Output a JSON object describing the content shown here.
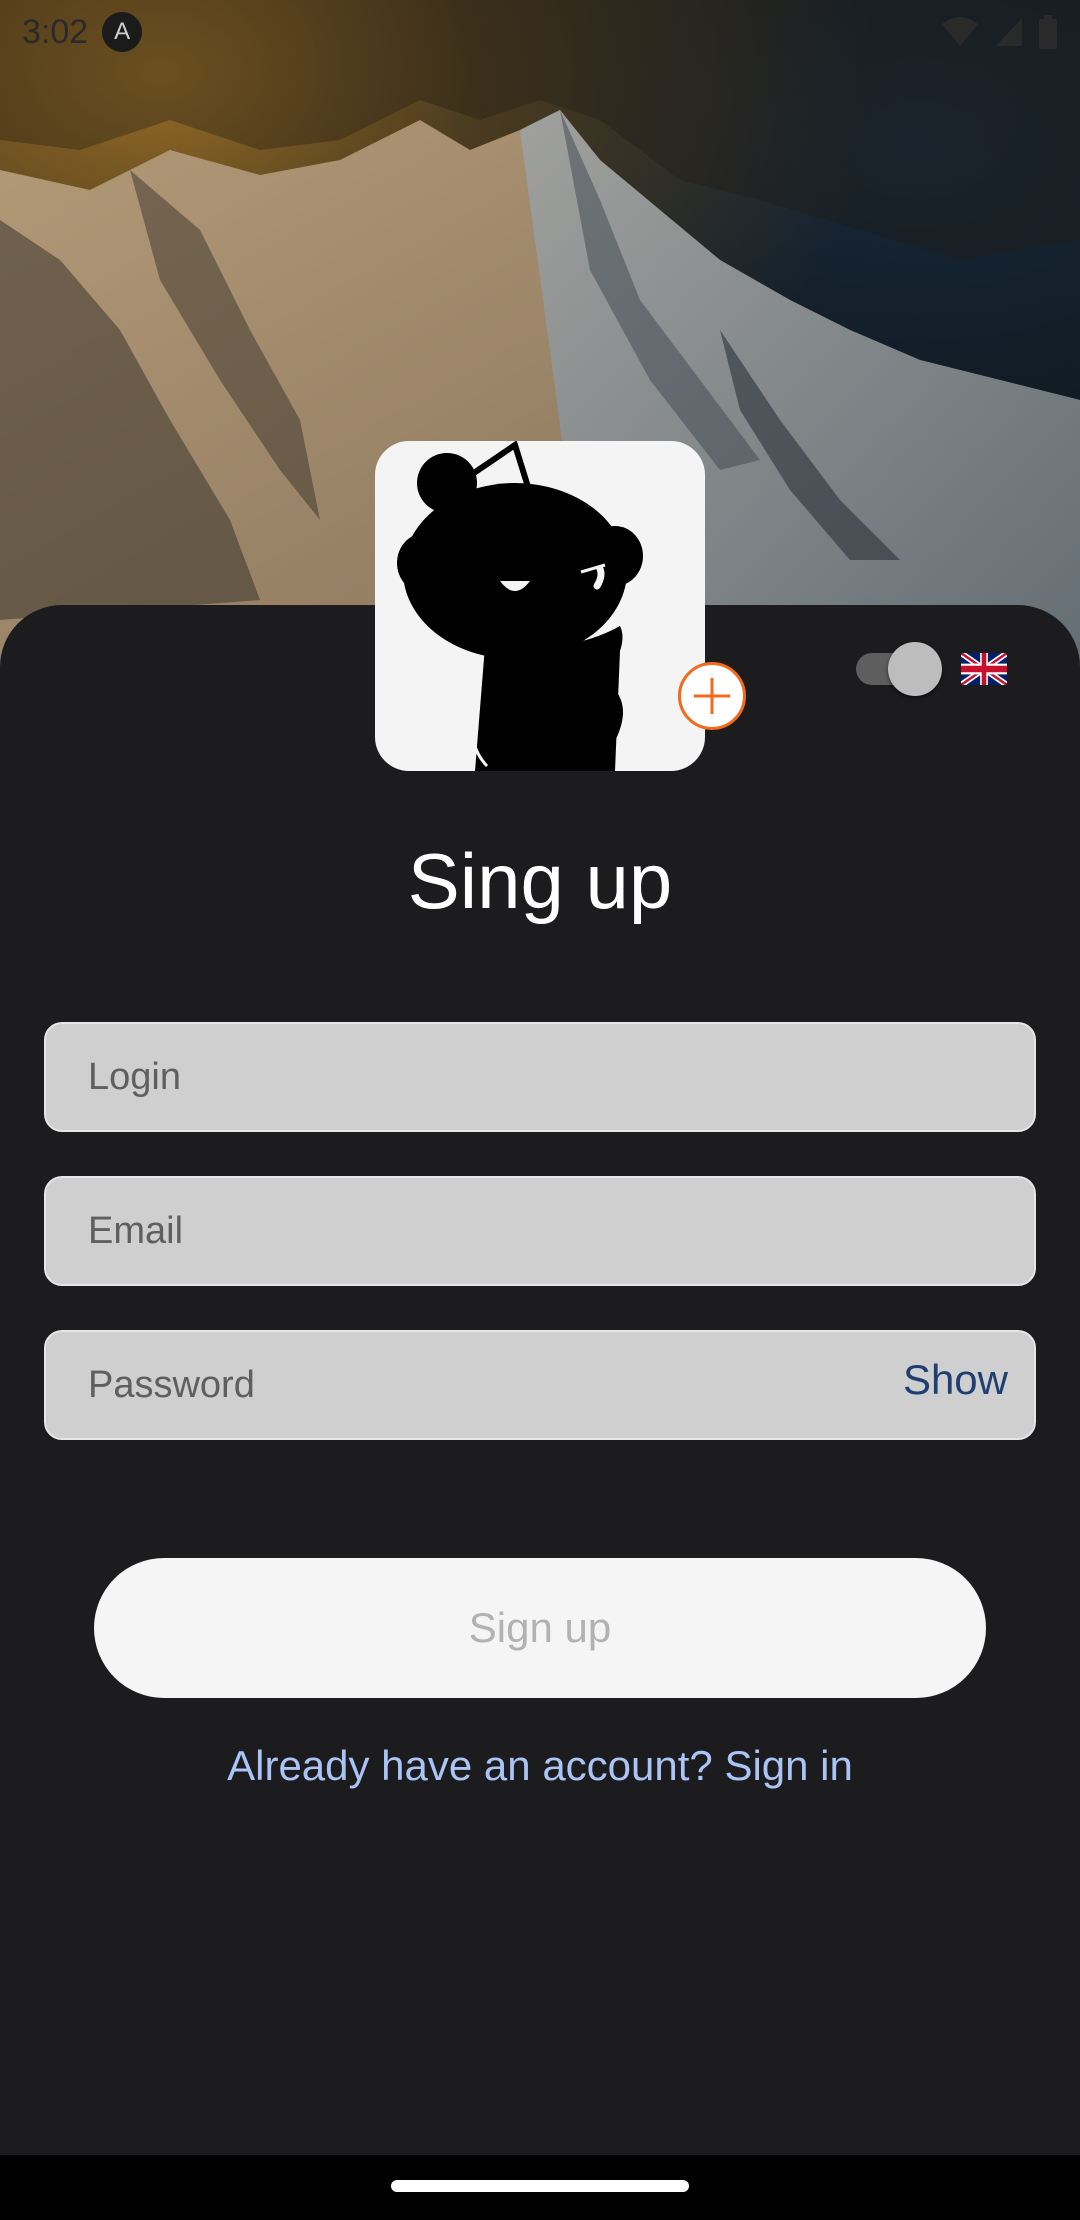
{
  "status_bar": {
    "time": "3:02",
    "app_icon": "A"
  },
  "icons": {
    "wifi": "wifi-icon",
    "signal": "signal-icon",
    "battery": "battery-icon",
    "add": "add-photo-icon",
    "flag": "uk-flag-icon"
  },
  "form": {
    "title": "Sing up",
    "login_placeholder": "Login",
    "email_placeholder": "Email",
    "password_placeholder": "Password",
    "show_label": "Show",
    "submit_label": "Sign up",
    "signin_link": "Already have an account? Sign in"
  },
  "colors": {
    "sheet": "#1c1c1e",
    "accent_orange": "#f26a1b",
    "link_blue": "#aac4f5",
    "show_blue": "#1f3f73"
  }
}
